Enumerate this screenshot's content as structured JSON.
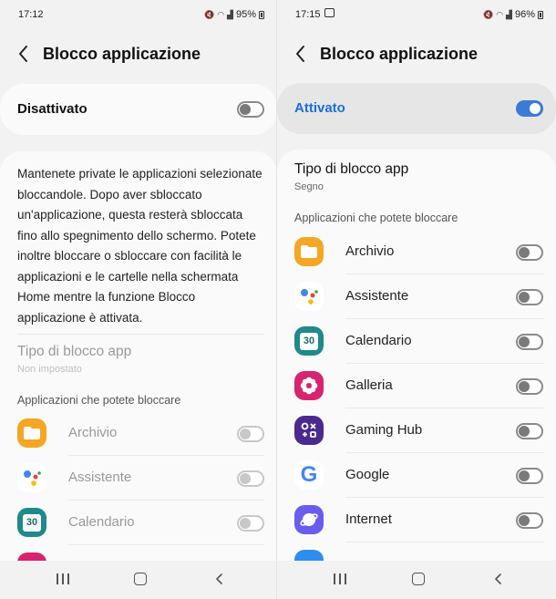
{
  "left": {
    "status": {
      "time": "17:12",
      "battery": "95%"
    },
    "header": {
      "title": "Blocco applicazione"
    },
    "master": {
      "label": "Disattivato",
      "on": false
    },
    "description": "Mantenete private le applicazioni selezionate bloccandole. Dopo aver sbloccato un'applicazione, questa resterà sbloccata fino allo spegnimento dello schermo. Potete inoltre bloccare o sbloccare con facilità le applicazioni e le cartelle nella schermata Home mentre la funzione Blocco applicazione è attivata.",
    "lock_type": {
      "title": "Tipo di blocco app",
      "value": "Non impostato"
    },
    "section_label": "Applicazioni che potete bloccare",
    "apps": [
      {
        "name": "Archivio",
        "icon": "folder-icon"
      },
      {
        "name": "Assistente",
        "icon": "assistant-icon"
      },
      {
        "name": "Calendario",
        "icon": "calendar-icon",
        "icon_text": "30"
      }
    ]
  },
  "right": {
    "status": {
      "time": "17:15",
      "battery": "96%"
    },
    "header": {
      "title": "Blocco applicazione"
    },
    "master": {
      "label": "Attivato",
      "on": true
    },
    "lock_type": {
      "title": "Tipo di blocco app",
      "value": "Segno"
    },
    "section_label": "Applicazioni che potete bloccare",
    "apps": [
      {
        "name": "Archivio",
        "icon": "folder-icon"
      },
      {
        "name": "Assistente",
        "icon": "assistant-icon"
      },
      {
        "name": "Calendario",
        "icon": "calendar-icon",
        "icon_text": "30"
      },
      {
        "name": "Galleria",
        "icon": "gallery-flower-icon"
      },
      {
        "name": "Gaming Hub",
        "icon": "gaming-hub-icon"
      },
      {
        "name": "Google",
        "icon": "google-g-icon",
        "icon_text": "G"
      },
      {
        "name": "Internet",
        "icon": "internet-icon"
      }
    ]
  },
  "colors": {
    "accent": "#3a7bd5",
    "active_label": "#1a6ed8"
  }
}
